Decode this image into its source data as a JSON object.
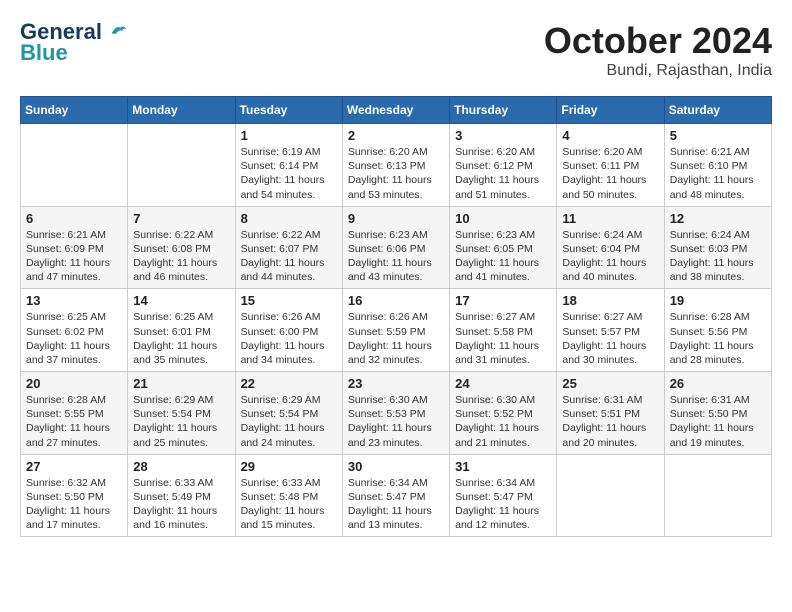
{
  "header": {
    "logo_line1": "General",
    "logo_line2": "Blue",
    "month": "October 2024",
    "location": "Bundi, Rajasthan, India"
  },
  "weekdays": [
    "Sunday",
    "Monday",
    "Tuesday",
    "Wednesday",
    "Thursday",
    "Friday",
    "Saturday"
  ],
  "weeks": [
    [
      {
        "day": "",
        "text": ""
      },
      {
        "day": "",
        "text": ""
      },
      {
        "day": "1",
        "text": "Sunrise: 6:19 AM\nSunset: 6:14 PM\nDaylight: 11 hours and 54 minutes."
      },
      {
        "day": "2",
        "text": "Sunrise: 6:20 AM\nSunset: 6:13 PM\nDaylight: 11 hours and 53 minutes."
      },
      {
        "day": "3",
        "text": "Sunrise: 6:20 AM\nSunset: 6:12 PM\nDaylight: 11 hours and 51 minutes."
      },
      {
        "day": "4",
        "text": "Sunrise: 6:20 AM\nSunset: 6:11 PM\nDaylight: 11 hours and 50 minutes."
      },
      {
        "day": "5",
        "text": "Sunrise: 6:21 AM\nSunset: 6:10 PM\nDaylight: 11 hours and 48 minutes."
      }
    ],
    [
      {
        "day": "6",
        "text": "Sunrise: 6:21 AM\nSunset: 6:09 PM\nDaylight: 11 hours and 47 minutes."
      },
      {
        "day": "7",
        "text": "Sunrise: 6:22 AM\nSunset: 6:08 PM\nDaylight: 11 hours and 46 minutes."
      },
      {
        "day": "8",
        "text": "Sunrise: 6:22 AM\nSunset: 6:07 PM\nDaylight: 11 hours and 44 minutes."
      },
      {
        "day": "9",
        "text": "Sunrise: 6:23 AM\nSunset: 6:06 PM\nDaylight: 11 hours and 43 minutes."
      },
      {
        "day": "10",
        "text": "Sunrise: 6:23 AM\nSunset: 6:05 PM\nDaylight: 11 hours and 41 minutes."
      },
      {
        "day": "11",
        "text": "Sunrise: 6:24 AM\nSunset: 6:04 PM\nDaylight: 11 hours and 40 minutes."
      },
      {
        "day": "12",
        "text": "Sunrise: 6:24 AM\nSunset: 6:03 PM\nDaylight: 11 hours and 38 minutes."
      }
    ],
    [
      {
        "day": "13",
        "text": "Sunrise: 6:25 AM\nSunset: 6:02 PM\nDaylight: 11 hours and 37 minutes."
      },
      {
        "day": "14",
        "text": "Sunrise: 6:25 AM\nSunset: 6:01 PM\nDaylight: 11 hours and 35 minutes."
      },
      {
        "day": "15",
        "text": "Sunrise: 6:26 AM\nSunset: 6:00 PM\nDaylight: 11 hours and 34 minutes."
      },
      {
        "day": "16",
        "text": "Sunrise: 6:26 AM\nSunset: 5:59 PM\nDaylight: 11 hours and 32 minutes."
      },
      {
        "day": "17",
        "text": "Sunrise: 6:27 AM\nSunset: 5:58 PM\nDaylight: 11 hours and 31 minutes."
      },
      {
        "day": "18",
        "text": "Sunrise: 6:27 AM\nSunset: 5:57 PM\nDaylight: 11 hours and 30 minutes."
      },
      {
        "day": "19",
        "text": "Sunrise: 6:28 AM\nSunset: 5:56 PM\nDaylight: 11 hours and 28 minutes."
      }
    ],
    [
      {
        "day": "20",
        "text": "Sunrise: 6:28 AM\nSunset: 5:55 PM\nDaylight: 11 hours and 27 minutes."
      },
      {
        "day": "21",
        "text": "Sunrise: 6:29 AM\nSunset: 5:54 PM\nDaylight: 11 hours and 25 minutes."
      },
      {
        "day": "22",
        "text": "Sunrise: 6:29 AM\nSunset: 5:54 PM\nDaylight: 11 hours and 24 minutes."
      },
      {
        "day": "23",
        "text": "Sunrise: 6:30 AM\nSunset: 5:53 PM\nDaylight: 11 hours and 23 minutes."
      },
      {
        "day": "24",
        "text": "Sunrise: 6:30 AM\nSunset: 5:52 PM\nDaylight: 11 hours and 21 minutes."
      },
      {
        "day": "25",
        "text": "Sunrise: 6:31 AM\nSunset: 5:51 PM\nDaylight: 11 hours and 20 minutes."
      },
      {
        "day": "26",
        "text": "Sunrise: 6:31 AM\nSunset: 5:50 PM\nDaylight: 11 hours and 19 minutes."
      }
    ],
    [
      {
        "day": "27",
        "text": "Sunrise: 6:32 AM\nSunset: 5:50 PM\nDaylight: 11 hours and 17 minutes."
      },
      {
        "day": "28",
        "text": "Sunrise: 6:33 AM\nSunset: 5:49 PM\nDaylight: 11 hours and 16 minutes."
      },
      {
        "day": "29",
        "text": "Sunrise: 6:33 AM\nSunset: 5:48 PM\nDaylight: 11 hours and 15 minutes."
      },
      {
        "day": "30",
        "text": "Sunrise: 6:34 AM\nSunset: 5:47 PM\nDaylight: 11 hours and 13 minutes."
      },
      {
        "day": "31",
        "text": "Sunrise: 6:34 AM\nSunset: 5:47 PM\nDaylight: 11 hours and 12 minutes."
      },
      {
        "day": "",
        "text": ""
      },
      {
        "day": "",
        "text": ""
      }
    ]
  ]
}
